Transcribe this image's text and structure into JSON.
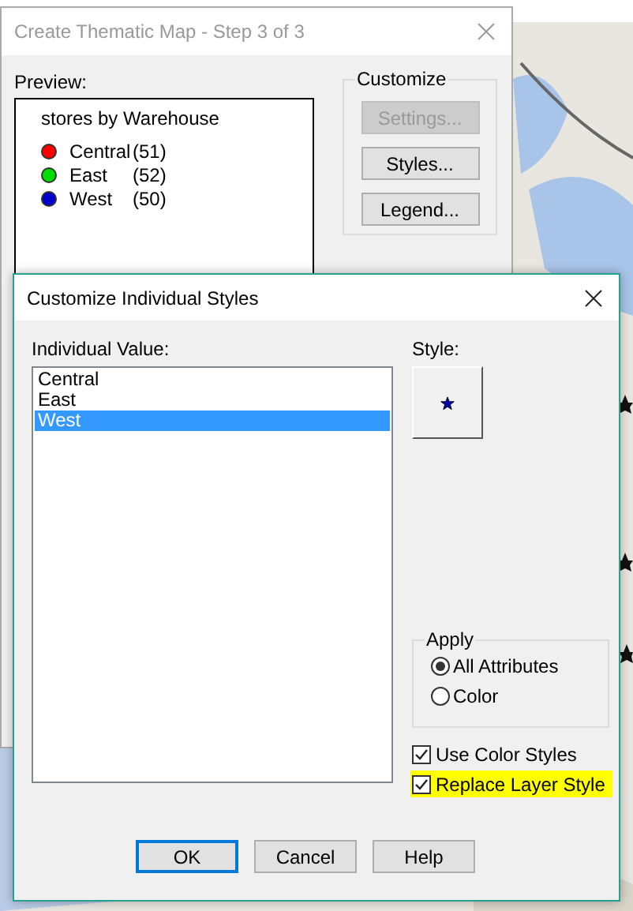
{
  "back_dialog": {
    "title": "Create Thematic Map - Step 3 of 3",
    "preview_label": "Preview:",
    "legend": {
      "title": "stores by Warehouse",
      "items": [
        {
          "name": "Central",
          "count": "(51)",
          "color": "#ff0000"
        },
        {
          "name": "East",
          "count": "(52)",
          "color": "#00dd00"
        },
        {
          "name": "West",
          "count": "(50)",
          "color": "#0000cc"
        }
      ]
    },
    "customize": {
      "label": "Customize",
      "buttons": [
        {
          "label": "Settings...",
          "disabled": true
        },
        {
          "label": "Styles...",
          "disabled": false
        },
        {
          "label": "Legend...",
          "disabled": false
        }
      ]
    }
  },
  "dialog": {
    "title": "Customize Individual Styles",
    "list_label": "Individual Value:",
    "values": [
      {
        "label": "Central",
        "selected": false
      },
      {
        "label": "East",
        "selected": false
      },
      {
        "label": "West",
        "selected": true
      }
    ],
    "style_label": "Style:",
    "apply": {
      "label": "Apply",
      "options": [
        {
          "label": "All Attributes",
          "selected": true
        },
        {
          "label": "Color",
          "selected": false
        }
      ]
    },
    "checkboxes": [
      {
        "label": "Use Color Styles",
        "checked": true,
        "highlighted": false
      },
      {
        "label": "Replace Layer Style",
        "checked": true,
        "highlighted": true
      }
    ],
    "buttons": [
      {
        "label": "OK",
        "default": true
      },
      {
        "label": "Cancel",
        "default": false
      },
      {
        "label": "Help",
        "default": false
      }
    ]
  }
}
